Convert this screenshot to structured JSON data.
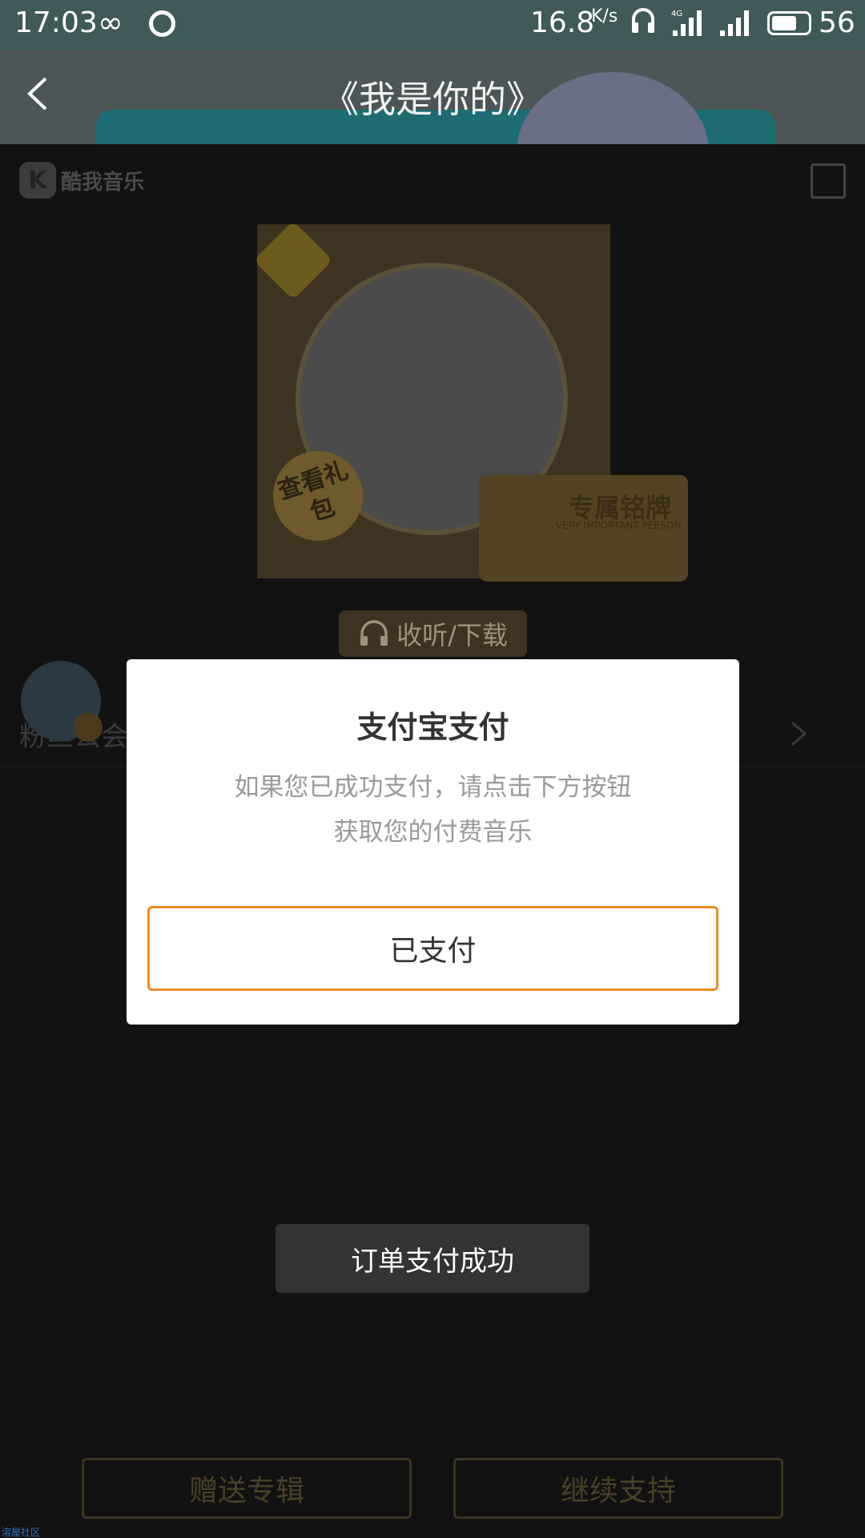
{
  "status_bar": {
    "time": "17:03",
    "loop_icon": "∞",
    "net_speed": "16.8",
    "net_unit": "K/s",
    "network_4g": "4G",
    "battery": "56"
  },
  "header": {
    "back_icon": "chevron-left-icon",
    "title": "《我是你的》"
  },
  "page": {
    "logo_text": "酷我音乐",
    "share_icon": "share-icon",
    "gift_badge": "查看礼包",
    "vip_card_title": "专属铭牌",
    "vip_card_subtitle": "VERY IMPORTANT PERSON",
    "listen_button": "收听/下载",
    "fans_section": "粉丝公会"
  },
  "modal": {
    "title": "支付宝支付",
    "description_line1": "如果您已成功支付，请点击下方按钮",
    "description_line2": "获取您的付费音乐",
    "paid_button": "已支付",
    "accent_color": "#f08a24"
  },
  "toast": {
    "text": "订单支付成功"
  },
  "bottom": {
    "gift_album": "赠送专辑",
    "continue_support": "继续支持"
  },
  "watermark": "溶屋社区"
}
